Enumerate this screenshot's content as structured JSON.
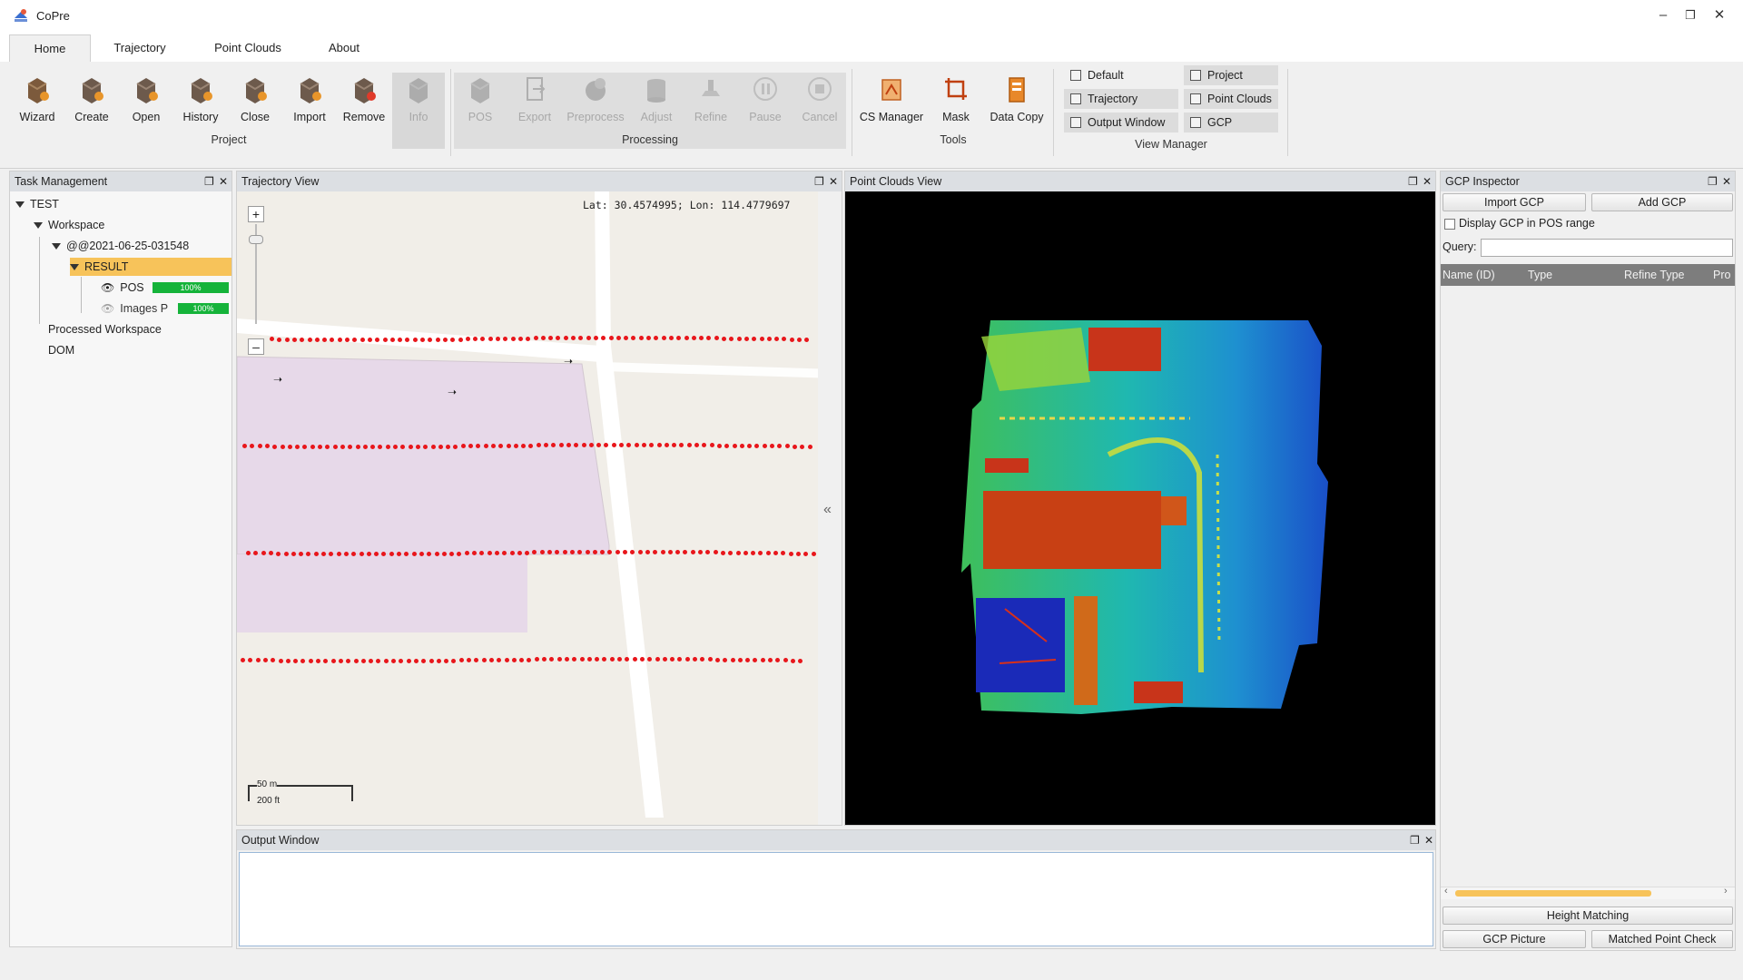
{
  "window": {
    "title": "CoPre"
  },
  "tabs": [
    {
      "label": "Home"
    },
    {
      "label": "Trajectory"
    },
    {
      "label": "Point Clouds"
    },
    {
      "label": "About"
    }
  ],
  "ribbon": {
    "project": {
      "label": "Project",
      "buttons": [
        "Wizard",
        "Create",
        "Open",
        "History",
        "Close",
        "Import",
        "Remove",
        "Info"
      ]
    },
    "processing": {
      "label": "Processing",
      "buttons": [
        "POS",
        "Export",
        "Preprocess",
        "Adjust",
        "Refine",
        "Pause",
        "Cancel"
      ]
    },
    "tools": {
      "label": "Tools",
      "buttons": [
        "CS Manager",
        "Mask",
        "Data Copy"
      ]
    },
    "view_manager": {
      "label": "View Manager",
      "buttons": [
        "Default",
        "Project",
        "Trajectory",
        "Point Clouds",
        "Output Window",
        "GCP"
      ]
    }
  },
  "task_management": {
    "title": "Task Management",
    "tree": {
      "root": "TEST",
      "workspace": "Workspace",
      "session": "@@2021-06-25-031548",
      "result": "RESULT",
      "pos": {
        "label": "POS",
        "progress": "100%"
      },
      "images": {
        "label": "Images P",
        "progress": "100%"
      },
      "processed": "Processed Workspace",
      "dom": "DOM"
    }
  },
  "trajectory_view": {
    "title": "Trajectory View",
    "coords": "Lat: 30.4574995; Lon: 114.4779697",
    "scale": {
      "metric": "50 m",
      "imperial": "200 ft"
    },
    "collapse_glyph": "«"
  },
  "point_clouds_view": {
    "title": "Point Clouds View"
  },
  "gcp_inspector": {
    "title": "GCP Inspector",
    "import_label": "Import GCP",
    "add_label": "Add GCP",
    "display_checkbox": "Display GCP in POS range",
    "query_label": "Query:",
    "query_value": "",
    "columns": [
      "Name (ID)",
      "Type",
      "Refine Type",
      "Pro"
    ],
    "height_matching": "Height Matching",
    "gcp_picture": "GCP Picture",
    "matched_point_check": "Matched Point Check"
  },
  "output_window": {
    "title": "Output Window"
  },
  "colors": {
    "accent": "#f7c35a",
    "progress": "#15b33a",
    "trajectory": "#e8161b",
    "panel_header": "#dcdfe3"
  }
}
